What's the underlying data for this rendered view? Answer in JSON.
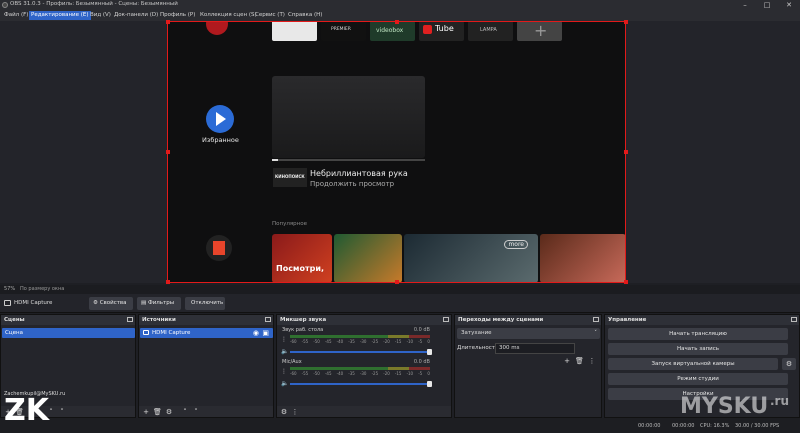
{
  "window": {
    "title": "OBS 31.0.3 - Профиль: Безымянный - Сцены: Безымянный"
  },
  "menu": {
    "items": [
      "Файл (F)",
      "Редактирование (E)",
      "Вид (V)",
      "Док-панели (D)",
      "Профиль (P)",
      "Коллекция сцен (S)",
      "Сервис (T)",
      "Справка (H)"
    ],
    "active_index": 1
  },
  "preview": {
    "app_tiles": [
      "PREMIER",
      "videobox",
      "Tube",
      "LAMPA"
    ],
    "favorites_label": "Избранное",
    "continue_title": "Небриллиантовая рука",
    "continue_subtitle": "Продолжить просмотр",
    "continue_thumb_text": "КИНОПОИСК",
    "popular_label": "Популярное",
    "promo_text": "Посмотри,",
    "more_badge": "more",
    "progress": 0.04
  },
  "statusline": {
    "zoom": "57%",
    "fit": "По размеру окна"
  },
  "source_toolbar": {
    "source_name": "HDMI Capture",
    "properties": "Свойства",
    "filters": "Фильтры",
    "disable": "Отключить"
  },
  "scenes": {
    "title": "Сцены",
    "items": [
      "Сцена"
    ],
    "overlay_text": "Zachemkupil@MySKU.ru"
  },
  "sources": {
    "title": "Источники",
    "items": [
      "HDMI Capture"
    ]
  },
  "mixer": {
    "title": "Микшер звука",
    "channels": [
      {
        "name": "Звук раб. стола",
        "db": "0.0 dB"
      },
      {
        "name": "Mic/Aux",
        "db": "0.0 dB"
      }
    ],
    "ticks": [
      "-60",
      "-55",
      "-50",
      "-45",
      "-40",
      "-35",
      "-30",
      "-25",
      "-20",
      "-15",
      "-10",
      "-5",
      "0"
    ]
  },
  "transitions": {
    "title": "Переходы между сценами",
    "type": "Затухание",
    "duration_label": "Длительность",
    "duration_value": "300 ms"
  },
  "controls": {
    "title": "Управление",
    "buttons": [
      "Начать трансляцию",
      "Начать запись",
      "Запуск виртуальной камеры",
      "Режим студии",
      "Настройки"
    ]
  },
  "bottombar": {
    "stream_time": "00:00:00",
    "rec_time": "00:00:00",
    "cpu": "CPU: 16.3%",
    "fps": "30.00 / 30.00 FPS"
  },
  "watermark": {
    "left": "ZK",
    "right": "MYSKU",
    "suffix": ".ru"
  }
}
